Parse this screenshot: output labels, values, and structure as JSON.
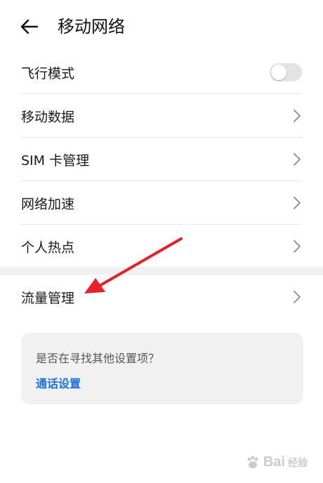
{
  "header": {
    "title": "移动网络",
    "back_icon": "arrow-left-icon"
  },
  "settings": {
    "airplane_mode": {
      "label": "飞行模式",
      "enabled": false
    },
    "mobile_data": {
      "label": "移动数据"
    },
    "sim_management": {
      "label": "SIM 卡管理"
    },
    "network_acceleration": {
      "label": "网络加速"
    },
    "personal_hotspot": {
      "label": "个人热点"
    },
    "traffic_management": {
      "label": "流量管理"
    }
  },
  "suggestion": {
    "question": "是否在寻找其他设置项？",
    "link": "通话设置"
  },
  "annotation": {
    "arrow_color": "#e8202a"
  },
  "watermark": {
    "brand": "Bai",
    "sub": "经验"
  },
  "colors": {
    "link": "#1a6fe0",
    "divider": "#e6e6e6",
    "card_bg": "#f1f1f1",
    "toggle_off": "#e3e3e3"
  }
}
